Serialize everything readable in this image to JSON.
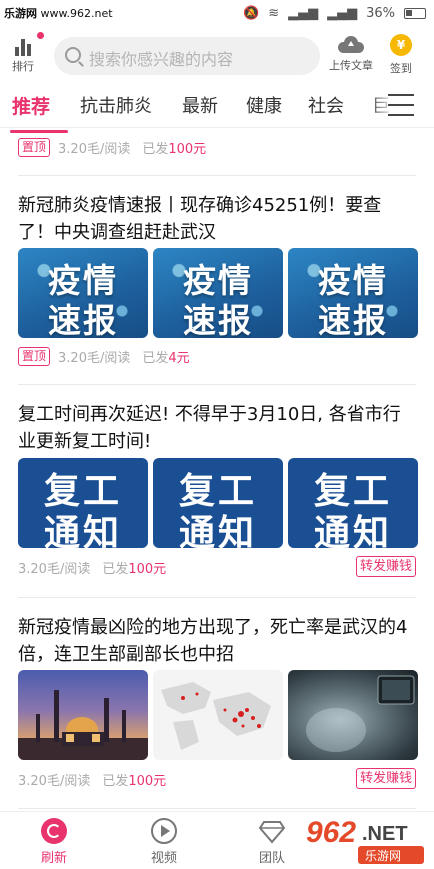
{
  "status_bar": {
    "watermark_prefix": "乐游网",
    "watermark_url": "www.962.net",
    "battery": "36%"
  },
  "topbar": {
    "rank_label": "排行",
    "search_placeholder": "搜索你感兴趣的内容",
    "upload_label": "上传文章",
    "sign_label": "签到",
    "coin_glyph": "¥"
  },
  "tabs": [
    {
      "label": "推荐",
      "active": true
    },
    {
      "label": "抗击肺炎"
    },
    {
      "label": "最新"
    },
    {
      "label": "健康"
    },
    {
      "label": "社会"
    },
    {
      "label": "巨"
    }
  ],
  "articles": [
    {
      "badge": "置顶",
      "meta_rate": "3.20毛/阅读",
      "meta_sent_prefix": "已发",
      "meta_amount": "100元"
    },
    {
      "title": "新冠肺炎疫情速报丨现存确诊45251例！要查了！中央调查组赶赴武汉",
      "image_line1": "疫情",
      "image_line2": "速报",
      "badge": "置顶",
      "meta_rate": "3.20毛/阅读",
      "meta_sent_prefix": "已发",
      "meta_amount": "4元"
    },
    {
      "title": "复工时间再次延迟! 不得早于3月10日, 各省市行业更新复工时间!",
      "image_line1": "复工",
      "image_line2": "通知",
      "meta_rate": "3.20毛/阅读",
      "meta_sent_prefix": "已发",
      "meta_amount": "100元",
      "share_label": "转发赚钱"
    },
    {
      "title": "新冠疫情最凶险的地方出现了，死亡率是武汉的4倍，连卫生部副部长也中招",
      "meta_rate": "3.20毛/阅读",
      "meta_sent_prefix": "已发",
      "meta_amount": "100元",
      "share_label": "转发赚钱"
    }
  ],
  "bottom_nav": [
    {
      "label": "刷新",
      "active": true
    },
    {
      "label": "视频"
    },
    {
      "label": "团队"
    }
  ],
  "watermark_logo": {
    "number": "962",
    "suffix": ".NET",
    "sub": "乐游网"
  },
  "colors": {
    "accent": "#e8336d",
    "tile_blue": "#1b4f93",
    "coin": "#f6b800"
  }
}
